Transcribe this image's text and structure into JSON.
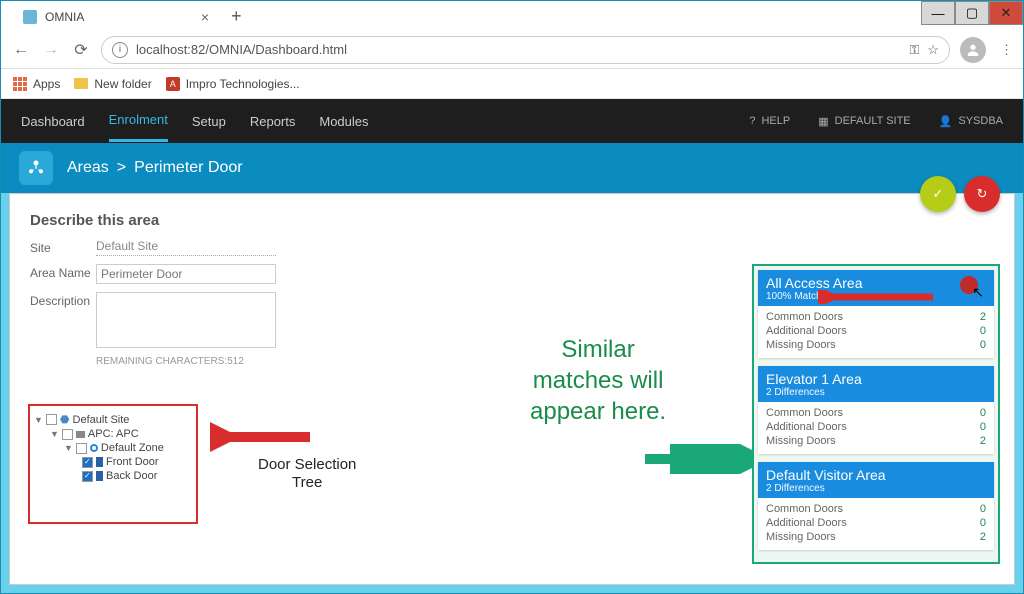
{
  "window": {
    "title": "OMNIA"
  },
  "browser": {
    "url": "localhost:82/OMNIA/Dashboard.html",
    "bookmarks": {
      "apps": "Apps",
      "newfolder": "New folder",
      "impro": "Impro Technologies..."
    }
  },
  "nav": {
    "items": [
      "Dashboard",
      "Enrolment",
      "Setup",
      "Reports",
      "Modules"
    ],
    "active": 1,
    "help": "HELP",
    "site": "DEFAULT SITE",
    "user": "SYSDBA"
  },
  "header": {
    "breadcrumb1": "Areas",
    "breadcrumb2": "Perimeter Door"
  },
  "form": {
    "title": "Describe this area",
    "site_label": "Site",
    "site_value": "Default Site",
    "name_label": "Area Name",
    "name_value": "Perimeter Door",
    "desc_label": "Description",
    "char_count": "REMAINING CHARACTERS:512"
  },
  "tree": {
    "site": "Default Site",
    "apc": "APC: APC",
    "zone": "Default Zone",
    "door1": "Front Door",
    "door2": "Back Door"
  },
  "annotations": {
    "door_tree": "Door Selection\nTree",
    "matches": "Similar\nmatches will\nappear here."
  },
  "matches": [
    {
      "title": "All Access Area",
      "sub": "100% Match",
      "rows": [
        {
          "label": "Common Doors",
          "value": "2"
        },
        {
          "label": "Additional Doors",
          "value": "0"
        },
        {
          "label": "Missing Doors",
          "value": "0"
        }
      ],
      "cursor": true
    },
    {
      "title": "Elevator 1 Area",
      "sub": "2 Differences",
      "rows": [
        {
          "label": "Common Doors",
          "value": "0"
        },
        {
          "label": "Additional Doors",
          "value": "0"
        },
        {
          "label": "Missing Doors",
          "value": "2"
        }
      ]
    },
    {
      "title": "Default Visitor Area",
      "sub": "2 Differences",
      "rows": [
        {
          "label": "Common Doors",
          "value": "0"
        },
        {
          "label": "Additional Doors",
          "value": "0"
        },
        {
          "label": "Missing Doors",
          "value": "2"
        }
      ]
    }
  ]
}
